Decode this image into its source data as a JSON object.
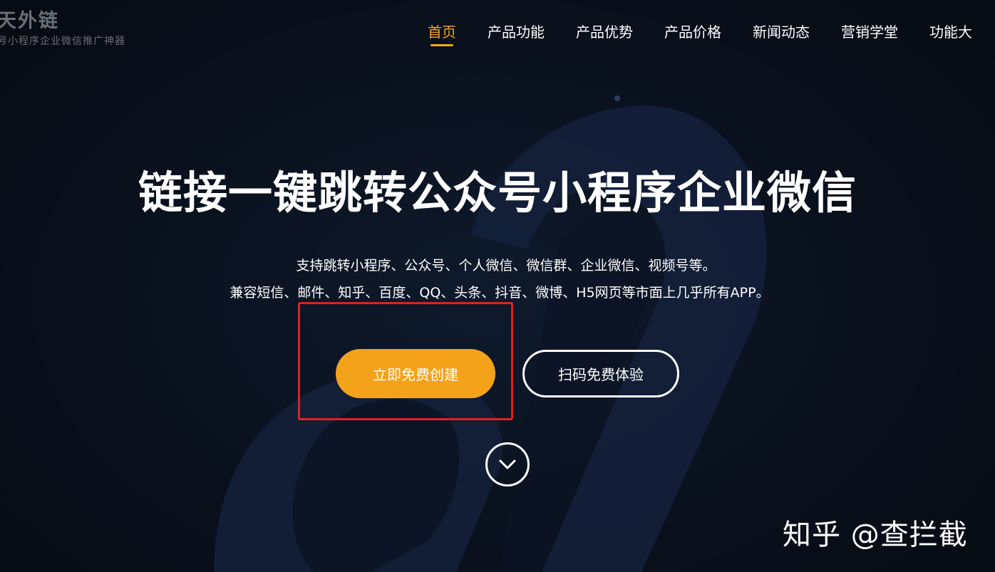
{
  "brand": {
    "name": "天外链",
    "tagline": "号小程序企业微信推广神器"
  },
  "nav": {
    "items": [
      {
        "label": "首页",
        "active": true
      },
      {
        "label": "产品功能",
        "active": false
      },
      {
        "label": "产品优势",
        "active": false
      },
      {
        "label": "产品价格",
        "active": false
      },
      {
        "label": "新闻动态",
        "active": false
      },
      {
        "label": "营销学堂",
        "active": false
      },
      {
        "label": "功能大",
        "active": false
      }
    ]
  },
  "hero": {
    "title": "链接一键跳转公众号小程序企业微信",
    "subtitle_line1": "支持跳转小程序、公众号、个人微信、微信群、企业微信、视频号等。",
    "subtitle_line2": "兼容短信、邮件、知乎、百度、QQ、头条、抖音、微博、H5网页等市面上几乎所有APP。",
    "primary_button": "立即免费创建",
    "secondary_button": "扫码免费体验"
  },
  "scroll": {
    "icon": "chevron-down-icon"
  },
  "watermark": {
    "text": "知乎 @查拦截"
  },
  "colors": {
    "accent": "#f5a623",
    "highlight": "#e02020",
    "background": "#0b1220"
  }
}
